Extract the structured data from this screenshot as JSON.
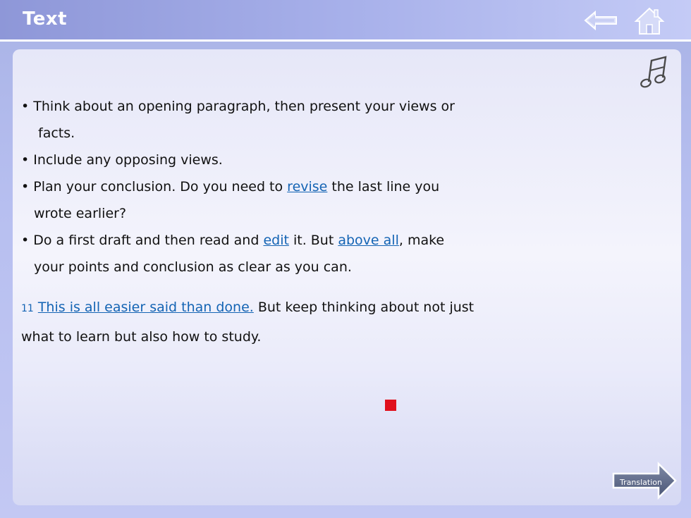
{
  "header": {
    "title": "Text"
  },
  "icons": {
    "back": "back-arrow-icon",
    "home": "home-icon",
    "music": "music-note-icon",
    "translation": "right-arrow-icon"
  },
  "content": {
    "bullets": [
      {
        "bullet": "•",
        "line1": "Think about an opening paragraph, then present your views or",
        "line2": "facts."
      },
      {
        "bullet": "•",
        "line1": "Include any opposing views."
      },
      {
        "bullet": "•",
        "pre": "Plan your conclusion. Do you need to ",
        "link": "revise",
        "post": " the last line you",
        "line2": "wrote earlier?"
      },
      {
        "bullet": "•",
        "pre": "Do a first draft and then read and ",
        "link1": "edit",
        "mid": " it. But ",
        "link2": "above all",
        "post": ", make",
        "line2": "your points and conclusion as clear as you can."
      }
    ],
    "paragraph": {
      "number": "11",
      "link": "This is all easier said than done.",
      "text": " But keep thinking about not just",
      "line2": "what to learn but also how to study."
    }
  },
  "buttons": {
    "translation_label": "Translation"
  },
  "colors": {
    "link": "#1464b4",
    "marker": "#e0101c",
    "header": "#8e97d8"
  }
}
